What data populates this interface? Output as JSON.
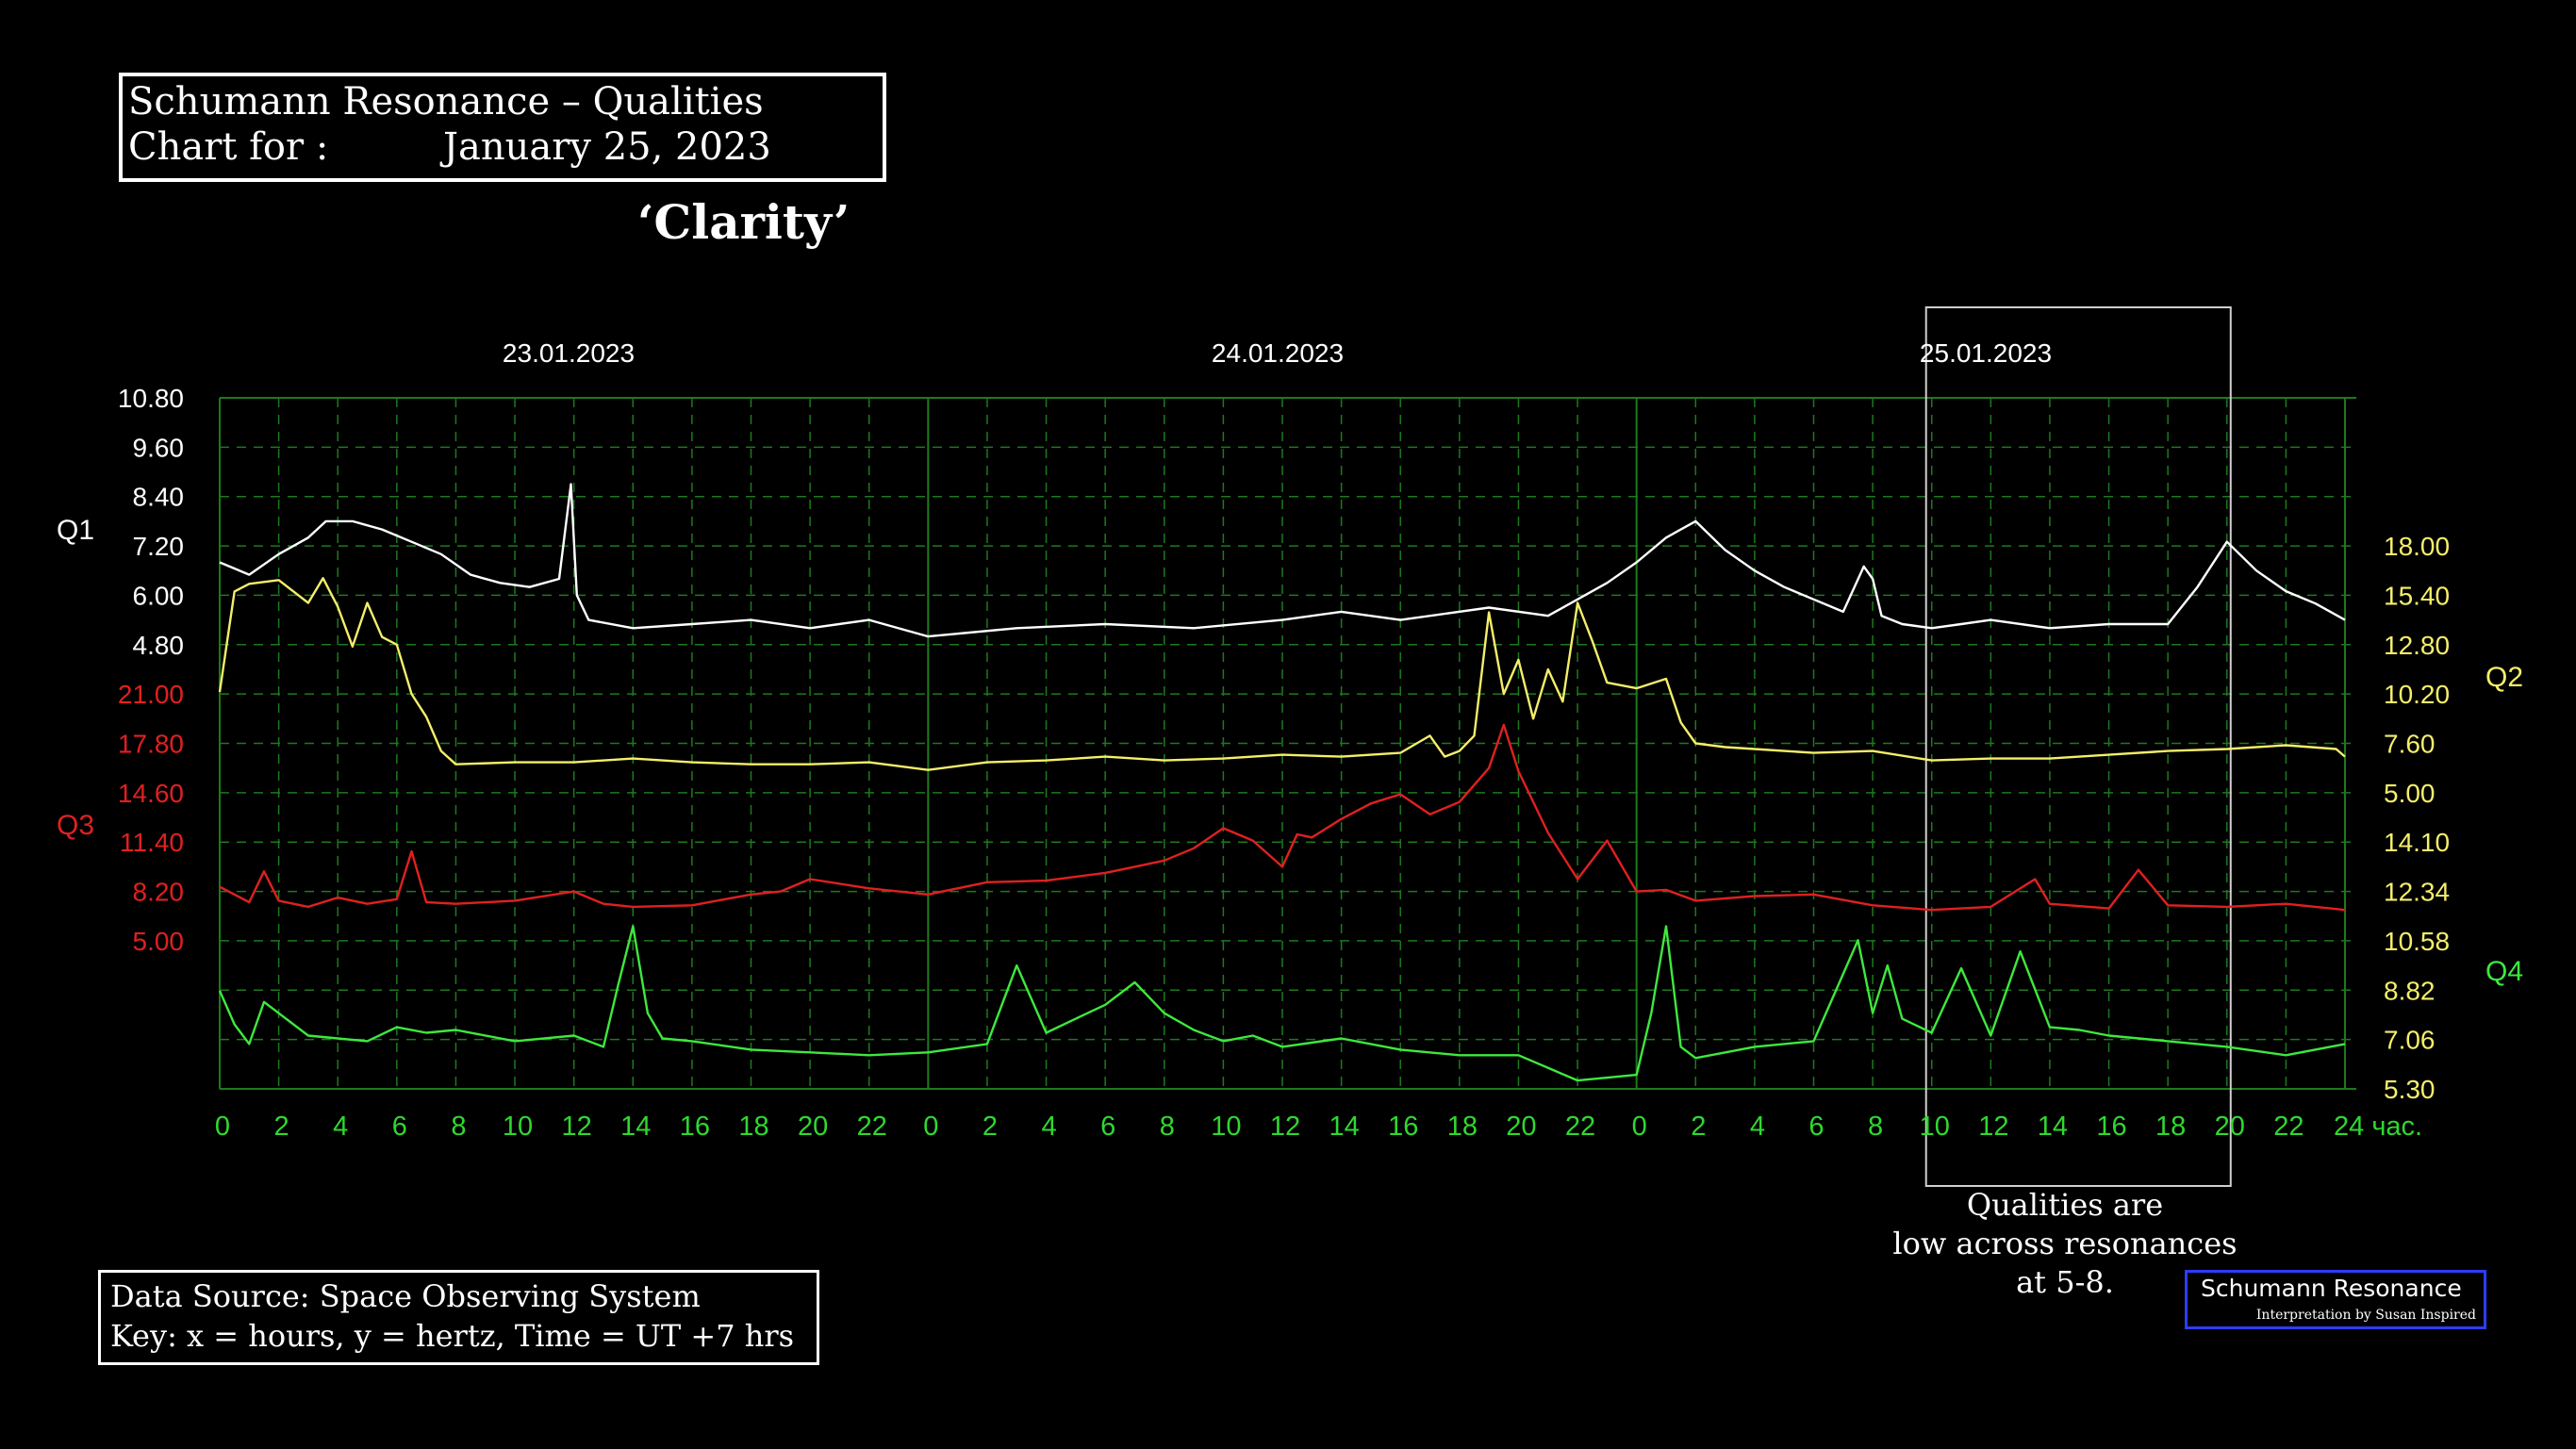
{
  "header": {
    "title": "Schumann Resonance – Qualities",
    "chart_for_label": "Chart for :",
    "date": "January 25, 2023",
    "subtitle": "‘Clarity’"
  },
  "source_box": {
    "line1": "Data Source: Space Observing System",
    "line2": "Key: x = hours, y = hertz, Time = UT +7 hrs"
  },
  "annotation": {
    "line1": "Qualities are",
    "line2": "low across resonances",
    "line3": "at 5-8."
  },
  "credit": {
    "main": "Schumann Resonance",
    "sub": "Interpretation by Susan Inspired"
  },
  "colors": {
    "background": "#000000",
    "grid": "#1d7a1d",
    "axis_text": "#2fd82f",
    "q1": "#ffffff",
    "q2": "#f5ee6a",
    "q3": "#e02020",
    "q4": "#3ee83e"
  },
  "chart_data": {
    "type": "line",
    "day_labels": [
      "23.01.2023",
      "24.01.2023",
      "25.01.2023"
    ],
    "x_ticks": [
      "0",
      "2",
      "4",
      "6",
      "8",
      "10",
      "12",
      "14",
      "16",
      "18",
      "20",
      "22",
      "0",
      "2",
      "4",
      "6",
      "8",
      "10",
      "12",
      "14",
      "16",
      "18",
      "20",
      "22",
      "0",
      "2",
      "4",
      "6",
      "8",
      "10",
      "12",
      "14",
      "16",
      "18",
      "20",
      "22",
      "24 час."
    ],
    "highlight_window_hours": [
      58,
      68
    ],
    "axes": [
      {
        "name": "Q1",
        "side": "left",
        "color": "#ffffff",
        "tick_color": "#ffffff",
        "ticks": [
          "10.80",
          "9.60",
          "8.40",
          "7.20",
          "6.00",
          "4.80"
        ],
        "range": [
          4.8,
          10.8
        ]
      },
      {
        "name": "Q3",
        "side": "left",
        "color": "#e02020",
        "tick_color": "#e02020",
        "ticks": [
          "21.00",
          "17.80",
          "14.60",
          "11.40",
          "8.20",
          "5.00"
        ],
        "range": [
          5.0,
          21.0
        ]
      },
      {
        "name": "Q2",
        "side": "right",
        "color": "#f5ee6a",
        "tick_color": "#f5ee6a",
        "ticks": [
          "18.00",
          "15.40",
          "12.80",
          "10.20",
          "7.60",
          "5.00"
        ],
        "range": [
          5.0,
          18.0
        ]
      },
      {
        "name": "Q4",
        "side": "right",
        "color": "#3ee83e",
        "tick_color": "#f5ee6a",
        "ticks": [
          "14.10",
          "12.34",
          "10.58",
          "8.82",
          "7.06",
          "5.30"
        ],
        "range": [
          5.3,
          14.1
        ]
      }
    ],
    "series": [
      {
        "name": "Q1",
        "color": "#ffffff",
        "x": [
          0,
          1,
          2,
          3,
          3.6,
          4.5,
          5.5,
          6.5,
          7.5,
          8.5,
          9.5,
          10.5,
          11.5,
          11.9,
          12.1,
          12.5,
          14,
          16,
          18,
          20,
          22,
          24,
          27,
          30,
          33,
          36,
          38,
          40,
          43,
          45,
          47,
          48,
          49,
          50,
          51,
          52,
          53,
          54,
          55,
          55.7,
          56,
          56.3,
          57,
          58,
          59,
          60,
          62,
          64,
          66,
          67,
          68,
          69,
          70,
          71,
          72
        ],
        "y": [
          6.8,
          6.5,
          7.0,
          7.4,
          7.8,
          7.8,
          7.6,
          7.3,
          7.0,
          6.5,
          6.3,
          6.2,
          6.4,
          8.7,
          6.0,
          5.4,
          5.2,
          5.3,
          5.4,
          5.2,
          5.4,
          5.0,
          5.2,
          5.3,
          5.2,
          5.4,
          5.6,
          5.4,
          5.7,
          5.5,
          6.3,
          6.8,
          7.4,
          7.8,
          7.1,
          6.6,
          6.2,
          5.9,
          5.6,
          6.7,
          6.4,
          5.5,
          5.3,
          5.2,
          5.3,
          5.4,
          5.2,
          5.3,
          5.3,
          6.2,
          7.3,
          6.6,
          6.1,
          5.8,
          5.4
        ]
      },
      {
        "name": "Q2",
        "color": "#f5ee6a",
        "x": [
          0,
          0.5,
          1,
          2,
          3,
          3.5,
          4,
          4.5,
          5,
          5.5,
          6,
          6.5,
          7,
          7.5,
          8,
          10,
          12,
          14,
          16,
          18,
          20,
          22,
          24,
          26,
          28,
          30,
          32,
          34,
          36,
          38,
          40,
          41,
          41.5,
          42,
          42.5,
          43,
          43.5,
          44,
          44.5,
          45,
          45.5,
          46,
          46.5,
          47,
          48,
          49,
          49.5,
          50,
          51,
          52,
          54,
          56,
          58,
          60,
          62,
          64,
          66,
          68,
          70,
          71.7,
          72
        ],
        "y": [
          10.3,
          15.6,
          16.0,
          16.2,
          15.0,
          16.3,
          14.8,
          12.7,
          15.0,
          13.2,
          12.8,
          10.2,
          9.0,
          7.2,
          6.5,
          6.6,
          6.6,
          6.8,
          6.6,
          6.5,
          6.5,
          6.6,
          6.2,
          6.6,
          6.7,
          6.9,
          6.7,
          6.8,
          7.0,
          6.9,
          7.1,
          8.0,
          6.9,
          7.2,
          8.0,
          14.5,
          10.2,
          12.0,
          8.9,
          11.5,
          9.8,
          15.0,
          13.0,
          10.8,
          10.5,
          11.0,
          8.7,
          7.6,
          7.4,
          7.3,
          7.1,
          7.2,
          6.7,
          6.8,
          6.8,
          7.0,
          7.2,
          7.3,
          7.5,
          7.3,
          6.9
        ]
      },
      {
        "name": "Q3",
        "color": "#e02020",
        "x": [
          0,
          1,
          1.5,
          2,
          3,
          4,
          5,
          6,
          6.5,
          7,
          8,
          10,
          12,
          13,
          14,
          16,
          18,
          19,
          20,
          22,
          24,
          26,
          28,
          30,
          31,
          32,
          33,
          34,
          35,
          36,
          36.5,
          37,
          38,
          39,
          40,
          41,
          42,
          43,
          43.5,
          44,
          45,
          46,
          47,
          48,
          49,
          50,
          52,
          54,
          56,
          58,
          60,
          61.5,
          62,
          64,
          65,
          66,
          68,
          70,
          72
        ],
        "y": [
          8.5,
          7.5,
          9.5,
          7.6,
          7.2,
          7.8,
          7.4,
          7.7,
          10.8,
          7.5,
          7.4,
          7.6,
          8.2,
          7.4,
          7.2,
          7.3,
          8.0,
          8.2,
          9.0,
          8.4,
          8.0,
          8.8,
          8.9,
          9.4,
          9.8,
          10.2,
          11.0,
          12.3,
          11.5,
          9.8,
          11.9,
          11.7,
          12.9,
          13.9,
          14.5,
          13.2,
          14.0,
          16.2,
          19.0,
          16.0,
          12.0,
          9.0,
          11.5,
          8.2,
          8.3,
          7.6,
          7.9,
          8.0,
          7.3,
          7.0,
          7.2,
          9.0,
          7.4,
          7.1,
          9.6,
          7.3,
          7.2,
          7.4,
          7.0
        ]
      },
      {
        "name": "Q4",
        "color": "#3ee83e",
        "x": [
          0,
          0.5,
          1,
          1.5,
          2,
          3,
          4,
          5,
          6,
          7,
          8,
          10,
          12,
          13,
          13.5,
          14,
          14.5,
          15,
          16,
          18,
          20,
          22,
          24,
          26,
          27,
          28,
          29,
          30,
          31,
          32,
          33,
          34,
          35,
          36,
          38,
          40,
          42,
          44,
          46,
          48,
          48.5,
          49,
          49.5,
          50,
          52,
          54,
          55.5,
          56,
          56.5,
          57,
          58,
          59,
          60,
          61,
          62,
          63,
          64,
          66,
          68,
          70,
          72
        ],
        "y": [
          8.8,
          7.6,
          6.9,
          8.4,
          8.0,
          7.2,
          7.1,
          7.0,
          7.5,
          7.3,
          7.4,
          7.0,
          7.2,
          6.8,
          9.0,
          11.1,
          8.0,
          7.1,
          7.0,
          6.7,
          6.6,
          6.5,
          6.6,
          6.9,
          9.7,
          7.3,
          7.8,
          8.3,
          9.1,
          8.0,
          7.4,
          7.0,
          7.2,
          6.8,
          7.1,
          6.7,
          6.5,
          6.5,
          5.6,
          5.8,
          8.0,
          11.1,
          6.8,
          6.4,
          6.8,
          7.0,
          10.6,
          8.0,
          9.7,
          7.8,
          7.3,
          9.6,
          7.2,
          10.2,
          7.5,
          7.4,
          7.2,
          7.0,
          6.8,
          6.5,
          6.9
        ]
      }
    ]
  }
}
